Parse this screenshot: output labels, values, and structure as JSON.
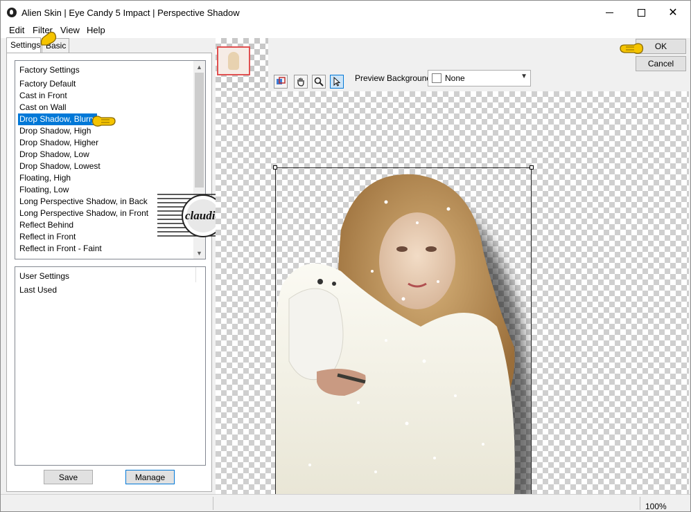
{
  "window": {
    "title": "Alien Skin | Eye Candy 5 Impact | Perspective Shadow"
  },
  "menu": [
    "Edit",
    "Filter",
    "View",
    "Help"
  ],
  "tabs": [
    "Settings",
    "Basic"
  ],
  "factory_settings": {
    "header": "Factory Settings",
    "items": [
      "Factory Default",
      "Cast in Front",
      "Cast on Wall",
      "Drop Shadow, Blurry",
      "Drop Shadow, High",
      "Drop Shadow, Higher",
      "Drop Shadow, Low",
      "Drop Shadow, Lowest",
      "Floating, High",
      "Floating, Low",
      "Long Perspective Shadow, in Back",
      "Long Perspective Shadow, in Front",
      "Reflect Behind",
      "Reflect in Front",
      "Reflect in Front - Faint"
    ],
    "selected": "Drop Shadow, Blurry"
  },
  "user_settings": {
    "header": "User Settings",
    "items": [
      "Last Used"
    ]
  },
  "buttons": {
    "save": "Save",
    "manage": "Manage",
    "ok": "OK",
    "cancel": "Cancel"
  },
  "preview": {
    "background_label": "Preview Background:",
    "background_value": "None"
  },
  "watermark_text": "claudia",
  "status": {
    "zoom": "100%"
  },
  "colors": {
    "selection": "#0078d7",
    "pointer": "#f5c400"
  }
}
